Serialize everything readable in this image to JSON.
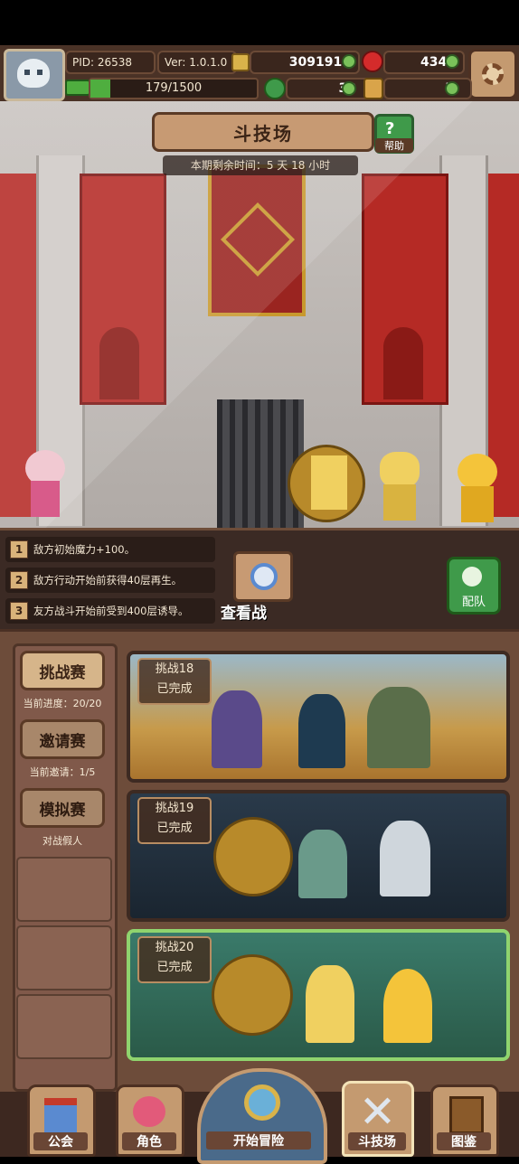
{
  "hud": {
    "pid": "PID: 26538",
    "version": "Ver: 1.0.1.0",
    "gold": "3091916",
    "gems": "4341",
    "stamina": "179/1500",
    "clover": "30",
    "boost": "5"
  },
  "header": {
    "title": "斗技场",
    "help_label": "帮助",
    "timer": "本期剩余时间：5 天 18 小时"
  },
  "rules": [
    {
      "num": "1",
      "text": "敌方初始魔力+100。"
    },
    {
      "num": "2",
      "text": "敌方行动开始前获得40层再生。"
    },
    {
      "num": "3",
      "text": "友方战斗开始前受到400层诱导。"
    }
  ],
  "watch_battle": "查看战",
  "team_label": "配队",
  "sidebar": [
    {
      "label": "挑战赛",
      "caption": "当前进度：20/20"
    },
    {
      "label": "邀请赛",
      "caption": "当前邀请：1/5"
    },
    {
      "label": "模拟赛",
      "caption": "对战假人"
    }
  ],
  "challenges": [
    {
      "name": "挑战18",
      "status": "已完成"
    },
    {
      "name": "挑战19",
      "status": "已完成"
    },
    {
      "name": "挑战20",
      "status": "已完成"
    }
  ],
  "nav": [
    {
      "label": "公会"
    },
    {
      "label": "角色"
    },
    {
      "label": "开始冒险"
    },
    {
      "label": "斗技场"
    },
    {
      "label": "图鉴"
    }
  ],
  "colors": {
    "panel_brown": "#6d4c3a",
    "selected_border": "#8fd46e",
    "banner_red": "#b52a25"
  }
}
